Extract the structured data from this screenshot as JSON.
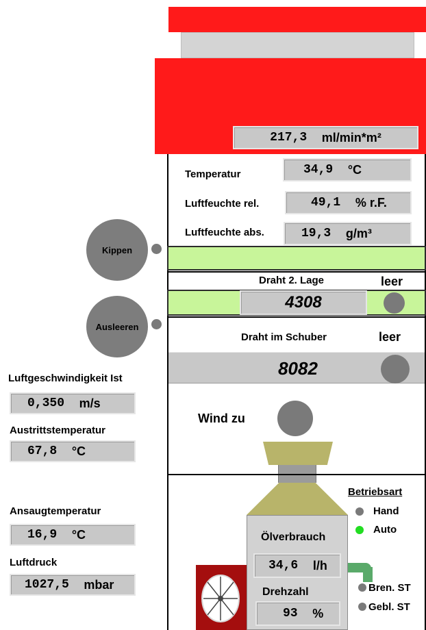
{
  "top": {
    "rate_value": "217,3",
    "rate_unit": "ml/min*m²"
  },
  "climate": {
    "temp_label": "Temperatur",
    "temp_value": "34,9",
    "temp_unit": "°C",
    "rh_label": "Luftfeuchte rel.",
    "rh_value": "49,1",
    "rh_unit": "% r.F.",
    "ah_label": "Luftfeuchte abs.",
    "ah_value": "19,3",
    "ah_unit": "g/m³"
  },
  "buttons": {
    "kippen": "Kippen",
    "ausleeren": "Ausleeren"
  },
  "wire2": {
    "label": "Draht 2. Lage",
    "status": "leer",
    "value": "4308"
  },
  "wire_schuber": {
    "label": "Draht im Schuber",
    "status": "leer",
    "value": "8082"
  },
  "wind": {
    "label": "Wind zu"
  },
  "left": {
    "air_speed_label": "Luftgeschwindigkeit Ist",
    "air_speed_value": "0,350",
    "air_speed_unit": "m/s",
    "outlet_label": "Austrittstemperatur",
    "outlet_value": "67,8",
    "outlet_unit": "°C",
    "intake_label": "Ansaugtemperatur",
    "intake_value": "16,9",
    "intake_unit": "°C",
    "pressure_label": "Luftdruck",
    "pressure_value": "1027,5",
    "pressure_unit": "mbar"
  },
  "burner": {
    "oil_label": "Ölverbrauch",
    "oil_value": "34,6",
    "oil_unit": "l/h",
    "speed_label": "Drehzahl",
    "speed_value": "93",
    "speed_unit": "%"
  },
  "mode": {
    "title": "Betriebsart",
    "hand": "Hand",
    "auto": "Auto",
    "bren": "Bren. ST",
    "gebl": "Gebl. ST",
    "colors": {
      "hand": "#7a7a7a",
      "auto": "#22dd22",
      "bren": "#7a7a7a",
      "gebl": "#7a7a7a"
    }
  },
  "colors": {
    "red": "#ff1a1a",
    "green": "#c8f59a",
    "olive": "#b8b46a",
    "fan_bg": "#a40e0e"
  }
}
